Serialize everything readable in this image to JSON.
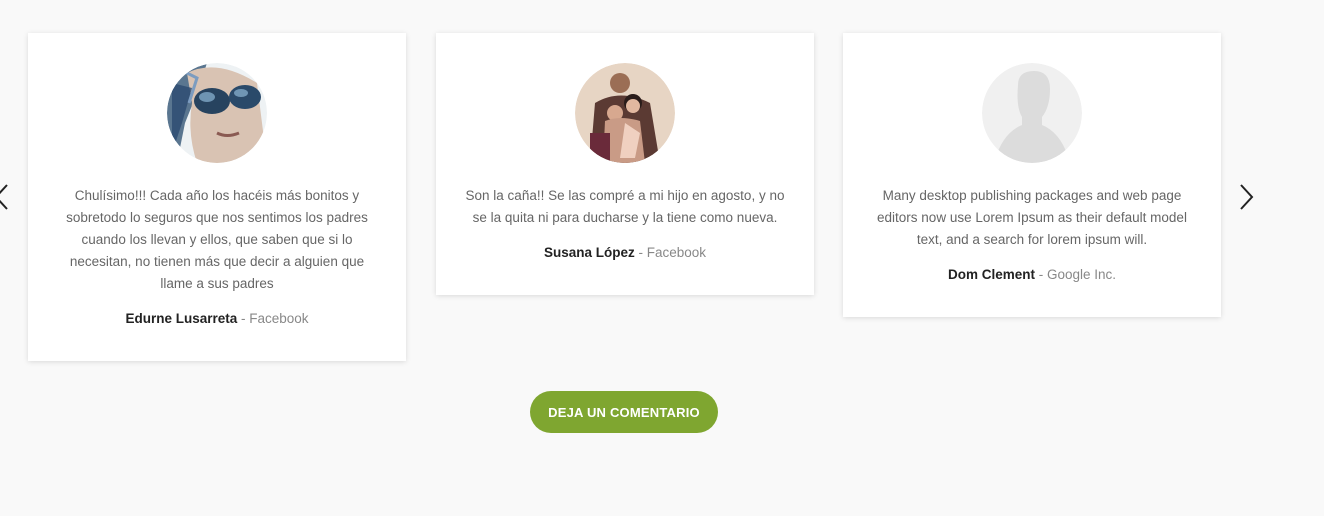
{
  "testimonials": [
    {
      "avatar_icon": "avatar-woman-sunglasses",
      "quote": "Chulísimo!!! Cada año los hacéis más bonitos y sobretodo lo seguros que nos sentimos los padres cuando los llevan y ellos, que saben que si lo necesitan, no tienen más que decir a alguien que llame a sus padres",
      "name": "Edurne Lusarreta",
      "source": " - Facebook"
    },
    {
      "avatar_icon": "avatar-family-photo",
      "quote": "Son la caña!! Se las compré a mi hijo en agosto, y no se la quita ni para ducharse y la tiene como nueva.",
      "name": "Susana López",
      "source": " - Facebook"
    },
    {
      "avatar_icon": "avatar-placeholder-silhouette",
      "quote": "Many desktop publishing packages and web page editors now use Lorem Ipsum as their default model text, and a search for lorem ipsum will.",
      "name": "Dom Clement",
      "source": " - Google Inc."
    }
  ],
  "carousel": {
    "prev_icon": "chevron-left-icon",
    "next_icon": "chevron-right-icon"
  },
  "cta": {
    "label": "DEJA UN COMENTARIO",
    "color": "#7fa630"
  }
}
